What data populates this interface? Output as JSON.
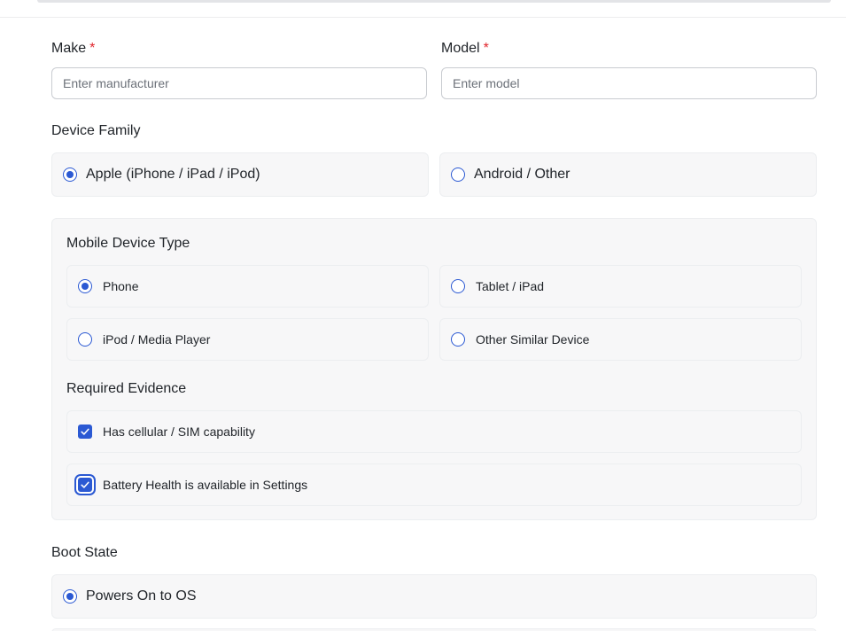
{
  "form": {
    "make": {
      "label": "Make",
      "required_mark": "*",
      "placeholder": "Enter manufacturer",
      "value": ""
    },
    "model": {
      "label": "Model",
      "required_mark": "*",
      "placeholder": "Enter model",
      "value": ""
    },
    "device_family": {
      "label": "Device Family",
      "options": [
        {
          "label": "Apple (iPhone / iPad / iPod)",
          "selected": true
        },
        {
          "label": "Android / Other",
          "selected": false
        }
      ]
    },
    "mobile_device_type": {
      "label": "Mobile Device Type",
      "options": [
        {
          "label": "Phone",
          "selected": true
        },
        {
          "label": "Tablet / iPad",
          "selected": false
        },
        {
          "label": "iPod / Media Player",
          "selected": false
        },
        {
          "label": "Other Similar Device",
          "selected": false
        }
      ]
    },
    "required_evidence": {
      "label": "Required Evidence",
      "items": [
        {
          "label": "Has cellular / SIM capability",
          "checked": true
        },
        {
          "label": "Battery Health is available in Settings",
          "checked": true,
          "focused": true
        }
      ]
    },
    "boot_state": {
      "label": "Boot State",
      "options": [
        {
          "label": "Powers On to OS",
          "selected": true
        }
      ]
    }
  },
  "colors": {
    "accent": "#2b59d3",
    "required": "#e0242b",
    "option_bg": "#f7f7f8"
  },
  "icons": {
    "checkmark": "check-icon",
    "radio": "radio-icon"
  }
}
